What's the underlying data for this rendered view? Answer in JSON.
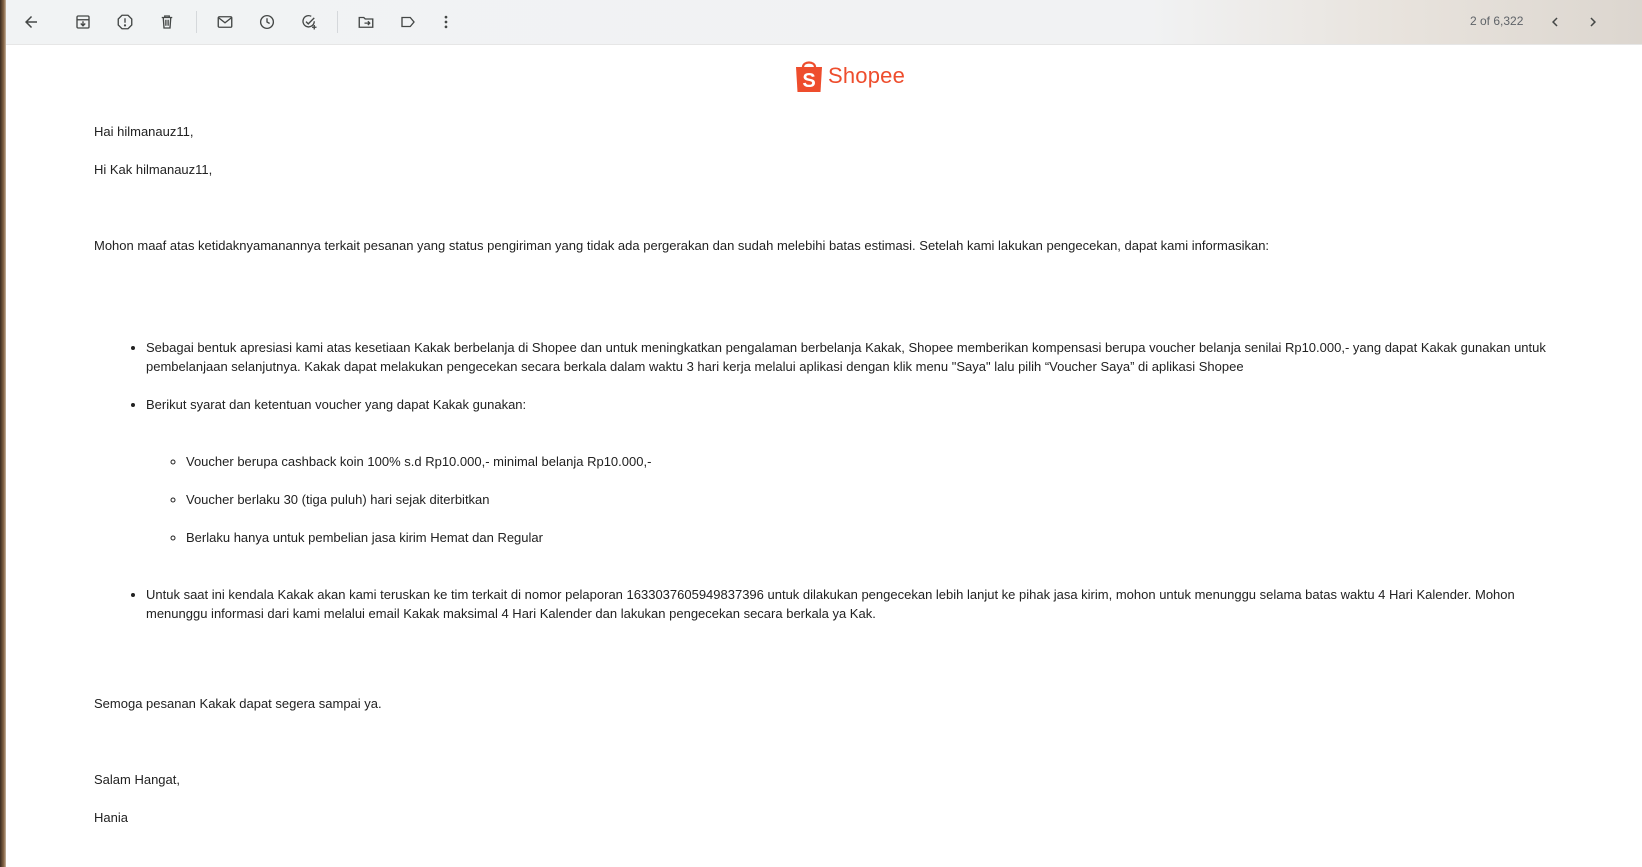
{
  "toolbar": {
    "page_count": "2 of 6,322",
    "icons": [
      "back-arrow-icon",
      "archive-icon",
      "report-spam-icon",
      "delete-icon",
      "mark-unread-icon",
      "snooze-icon",
      "add-task-icon",
      "move-to-icon",
      "label-icon",
      "more-icon",
      "newer-icon",
      "older-icon"
    ]
  },
  "email": {
    "brand": "Shopee",
    "greeting1": "Hai hilmanauz11,",
    "greeting2": "Hi Kak hilmanauz11,",
    "intro": "Mohon maaf atas ketidaknyamanannya terkait pesanan yang status pengiriman yang tidak ada pergerakan dan sudah melebihi batas estimasi. Setelah kami lakukan pengecekan, dapat kami informasikan:",
    "bullets": [
      "Sebagai bentuk apresiasi kami atas kesetiaan Kakak berbelanja di Shopee dan untuk meningkatkan pengalaman berbelanja Kakak, Shopee memberikan kompensasi berupa voucher belanja senilai Rp10.000,- yang dapat Kakak gunakan untuk pembelanjaan selanjutnya. Kakak dapat melakukan pengecekan secara berkala dalam waktu 3 hari kerja melalui aplikasi dengan klik menu \"Saya\" lalu pilih “Voucher Saya” di aplikasi Shopee",
      "Berikut syarat dan ketentuan voucher yang dapat Kakak gunakan:",
      "Untuk saat ini kendala Kakak akan kami teruskan ke tim terkait di nomor pelaporan 1633037605949837396 untuk dilakukan pengecekan lebih lanjut ke pihak jasa kirim, mohon untuk menunggu selama batas waktu 4 Hari Kalender. Mohon menunggu informasi dari kami melalui email Kakak maksimal 4 Hari Kalender dan lakukan pengecekan secara berkala ya Kak."
    ],
    "sub_bullets": [
      "Voucher berupa cashback koin 100% s.d Rp10.000,- minimal belanja Rp10.000,-",
      "Voucher berlaku 30 (tiga puluh) hari sejak diterbitkan",
      "Berlaku hanya untuk pembelian jasa kirim Hemat dan Regular"
    ],
    "closing": "Semoga pesanan Kakak dapat segera sampai ya.",
    "salutation": "Salam Hangat,",
    "signature": "Hania"
  },
  "colors": {
    "brand": "#ee4d2d",
    "icon": "#444746",
    "text": "#222222"
  }
}
